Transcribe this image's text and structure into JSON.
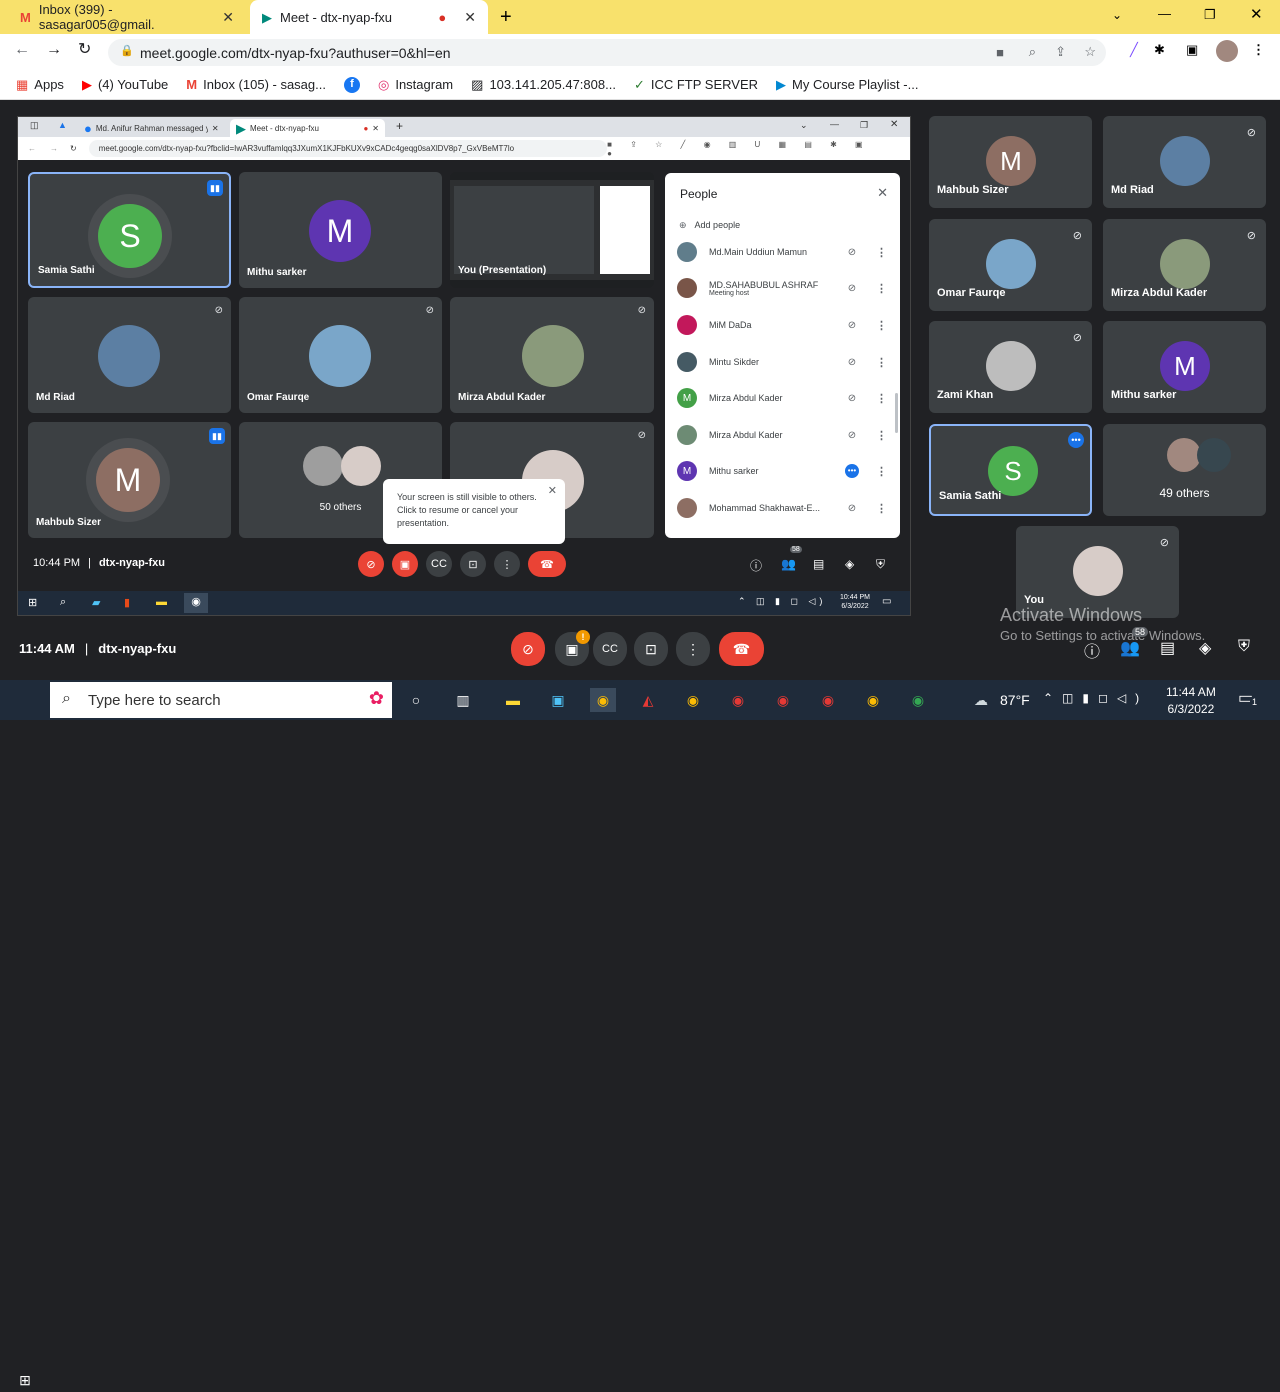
{
  "browser": {
    "tabs": [
      {
        "title": "Inbox (399) - sasagar005@gmail.",
        "icon": "gmail-icon"
      },
      {
        "title": "Meet - dtx-nyap-fxu",
        "icon": "meet-icon"
      }
    ],
    "url": "meet.google.com/dtx-nyap-fxu?authuser=0&hl=en",
    "bookmarks": [
      "Apps",
      "(4) YouTube",
      "Inbox (105) - sasag...",
      "Instagram",
      "103.141.205.47:808...",
      "ICC FTP SERVER",
      "My Course Playlist -..."
    ]
  },
  "inner_browser": {
    "tabs": [
      "Md. Anifur Rahman messaged y...",
      "Meet - dtx-nyap-fxu"
    ],
    "url": "meet.google.com/dtx-nyap-fxu?fbclid=IwAR3vuffamlqq3JXumX1KJFbKUXv9xCADc4geqg0saXlDV8p7_GxVBeMT7lo"
  },
  "inner_meet": {
    "tiles": [
      {
        "name": "Samia Sathi",
        "initial": "S",
        "color": "#4caf50"
      },
      {
        "name": "Mithu sarker",
        "initial": "M",
        "color": "#5e35b1"
      },
      {
        "name": "You (Presentation)"
      },
      {
        "name": "Md Riad"
      },
      {
        "name": "Omar Faurqe"
      },
      {
        "name": "Mirza Abdul Kader"
      },
      {
        "name": "Mahbub Sizer",
        "initial": "M",
        "color": "#8d6e63"
      },
      {
        "name": "50 others"
      }
    ],
    "popup_text": "Your screen is still visible to others. Click to resume or cancel your presentation.",
    "time": "10:44 PM",
    "meeting_code": "dtx-nyap-fxu",
    "people_badge": "58",
    "tray_time": "10:44 PM",
    "tray_date": "6/3/2022"
  },
  "people_panel": {
    "title": "People",
    "add_people": "Add people",
    "rows": [
      {
        "name": "Md.Main Uddiun Mamun",
        "sub": "",
        "color": "#607d8b",
        "initial": ""
      },
      {
        "name": "MD.SAHABUBUL ASHRAF",
        "sub": "Meeting host",
        "color": "#795548",
        "initial": ""
      },
      {
        "name": "MiM DaDa",
        "sub": "",
        "color": "#c2185b",
        "initial": ""
      },
      {
        "name": "Mintu Sikder",
        "sub": "",
        "color": "#455a64",
        "initial": ""
      },
      {
        "name": "Mirza Abdul Kader",
        "sub": "",
        "color": "#43a047",
        "initial": "M"
      },
      {
        "name": "Mirza Abdul Kader",
        "sub": "",
        "color": "#6d8b74",
        "initial": ""
      },
      {
        "name": "Mithu sarker",
        "sub": "",
        "color": "#5e35b1",
        "initial": "M"
      },
      {
        "name": "Mohammad Shakhawat-E...",
        "sub": "",
        "color": "#8d6e63",
        "initial": ""
      }
    ]
  },
  "right_grid": [
    {
      "name": "Mahbub Sizer",
      "initial": "M",
      "color": "#8d6e63"
    },
    {
      "name": "Md Riad"
    },
    {
      "name": "Omar Faurqe"
    },
    {
      "name": "Mirza Abdul Kader"
    },
    {
      "name": "Zami Khan"
    },
    {
      "name": "Mithu sarker",
      "initial": "M",
      "color": "#5e35b1"
    },
    {
      "name": "Samia Sathi",
      "initial": "S",
      "color": "#4caf50"
    },
    {
      "name": "49 others"
    },
    {
      "name": "You"
    }
  ],
  "meet_bar": {
    "time": "11:44 AM",
    "meeting_code": "dtx-nyap-fxu",
    "people_badge": "58"
  },
  "watermark": {
    "title": "Activate Windows",
    "subtitle": "Go to Settings to activate Windows."
  },
  "taskbar": {
    "search_placeholder": "Type here to search",
    "weather": "87°F",
    "time": "11:44 AM",
    "date": "6/3/2022",
    "notif_count": "1"
  }
}
